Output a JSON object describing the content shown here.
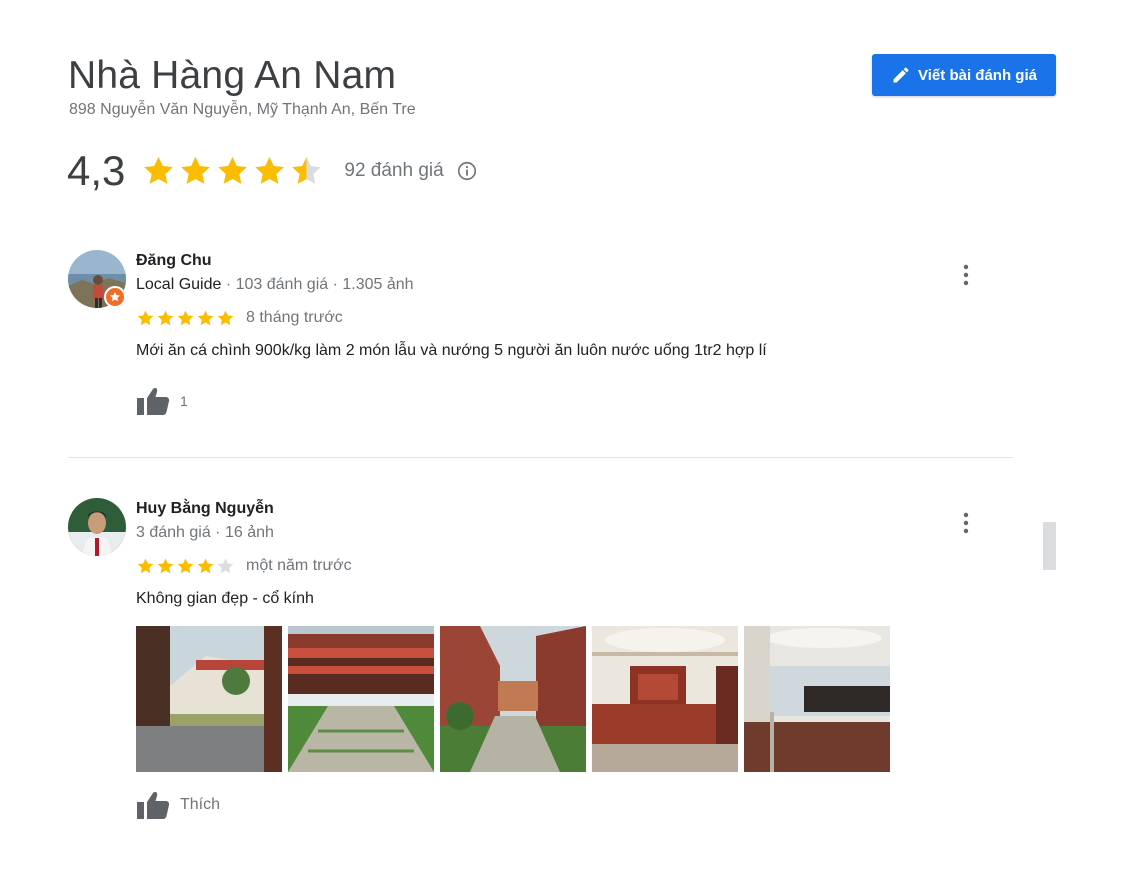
{
  "place": {
    "name": "Nhà Hàng An Nam",
    "address": "898 Nguyễn Văn Nguyễn, Mỹ Thạnh An, Bến Tre",
    "rating": "4,3",
    "rating_value": 4.3,
    "review_count": "92 đánh giá",
    "write_review_label": "Viết bài đánh giá"
  },
  "colors": {
    "accent": "#1a73e8",
    "star": "#fbbc04",
    "star_empty": "#dadce0",
    "local_guide_badge": "#f06d27"
  },
  "icons": {
    "write": "pencil-icon",
    "info": "info-icon",
    "more": "more-vertical-icon",
    "like": "thumbs-up-icon",
    "badge": "local-guide-badge-icon"
  },
  "reviews": [
    {
      "author": "Đăng Chu",
      "local_guide": "Local Guide",
      "stats": " · 103 đánh giá · 1.305 ảnh",
      "stars": 5,
      "time": "8 tháng trước",
      "text": "Mới ăn cá chình 900k/kg làm 2 món lẫu và nướng 5 người ăn luôn nước uống 1tr2 hợp lí",
      "likes": "1"
    },
    {
      "author": "Huy Bằng Nguyễn",
      "stats": "3 đánh giá · 16 ảnh",
      "stars": 4,
      "time": "một năm trước",
      "text": "Không gian đẹp - cổ kính",
      "photo_count": 5,
      "like_label": "Thích"
    }
  ]
}
